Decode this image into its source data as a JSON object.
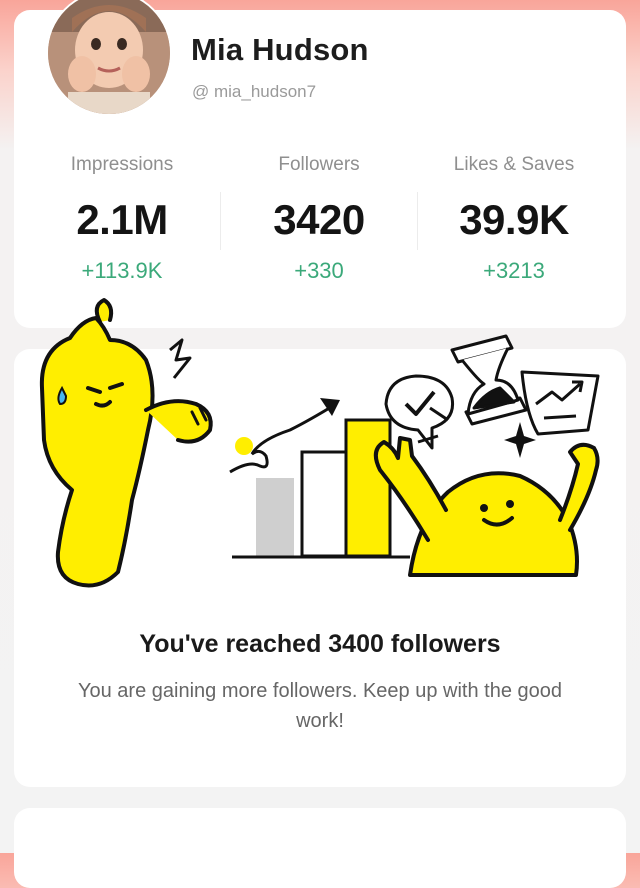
{
  "profile": {
    "name": "Mia Hudson",
    "handle": "@ mia_hudson7"
  },
  "stats": [
    {
      "label": "Impressions",
      "value": "2.1M",
      "delta": "+113.9K"
    },
    {
      "label": "Followers",
      "value": "3420",
      "delta": "+330"
    },
    {
      "label": "Likes & Saves",
      "value": "39.9K",
      "delta": "+3213"
    }
  ],
  "milestone": {
    "title": "You've reached 3400 followers",
    "subtitle": "You are gaining more followers. Keep up with the good work!"
  },
  "colors": {
    "accent_green": "#3ba97a",
    "mascot_yellow": "#ffee00",
    "header_pink": "#f9a59a"
  },
  "icons": [
    "lightning-icon",
    "hourglass-icon",
    "checkmark-bubble-icon",
    "sparkle-icon",
    "growth-arrow-icon",
    "chart-note-icon"
  ]
}
